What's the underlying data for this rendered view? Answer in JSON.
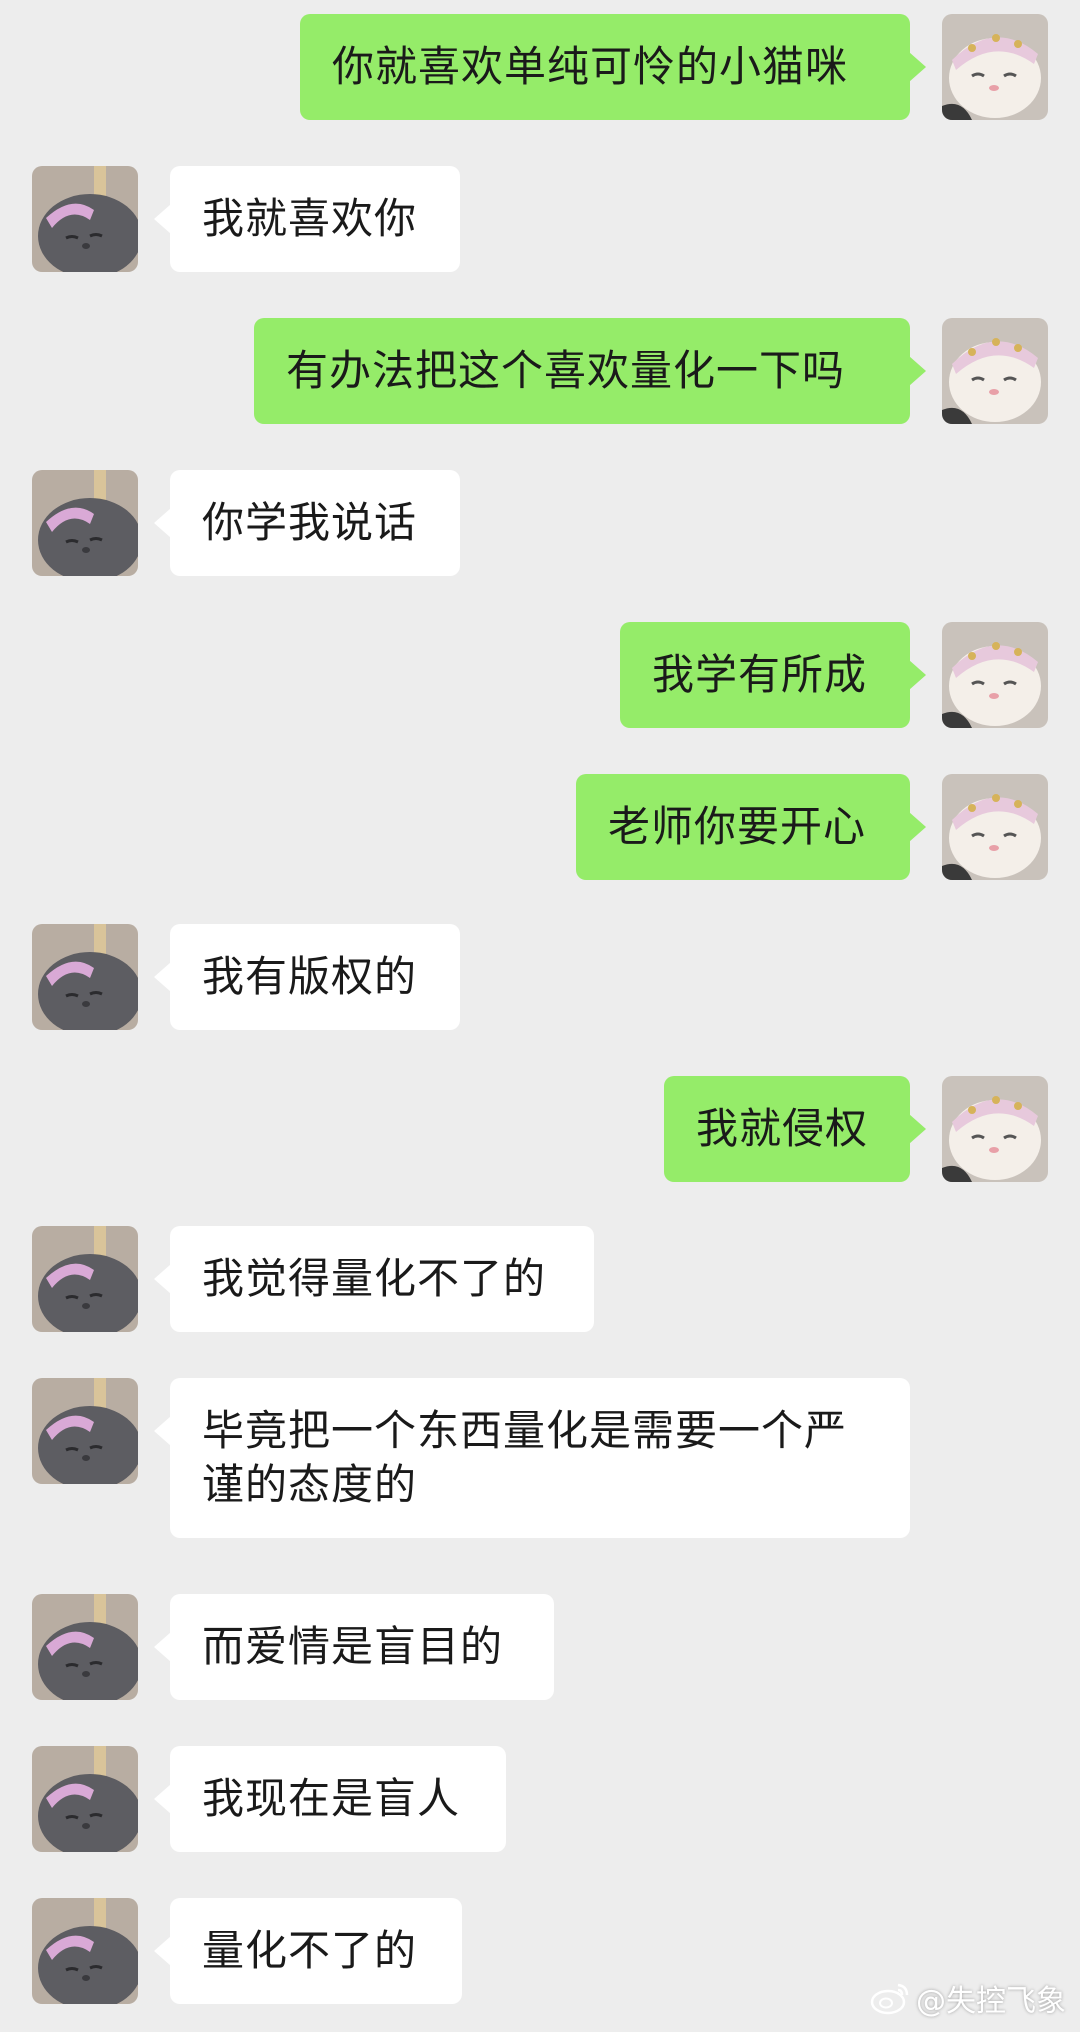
{
  "messages": [
    {
      "side": "self",
      "text": "你就喜欢单纯可怜的小猫咪"
    },
    {
      "side": "other",
      "text": "我就喜欢你"
    },
    {
      "side": "self",
      "text": "有办法把这个喜欢量化一下吗"
    },
    {
      "side": "other",
      "text": "你学我说话"
    },
    {
      "side": "self",
      "text": "我学有所成"
    },
    {
      "side": "self",
      "text": "老师你要开心"
    },
    {
      "side": "other",
      "text": "我有版权的"
    },
    {
      "side": "self",
      "text": "我就侵权"
    },
    {
      "side": "other",
      "text": "我觉得量化不了的"
    },
    {
      "side": "other",
      "text": "毕竟把一个东西量化是需要一个严谨的态度的"
    },
    {
      "side": "other",
      "text": "而爱情是盲目的"
    },
    {
      "side": "other",
      "text": "我现在是盲人"
    },
    {
      "side": "other",
      "text": "量化不了的"
    }
  ],
  "watermark": {
    "text": "@失控飞象",
    "icon": "weibo-icon"
  },
  "colors": {
    "background": "#ededed",
    "self_bubble": "#95ec69",
    "other_bubble": "#ffffff"
  }
}
